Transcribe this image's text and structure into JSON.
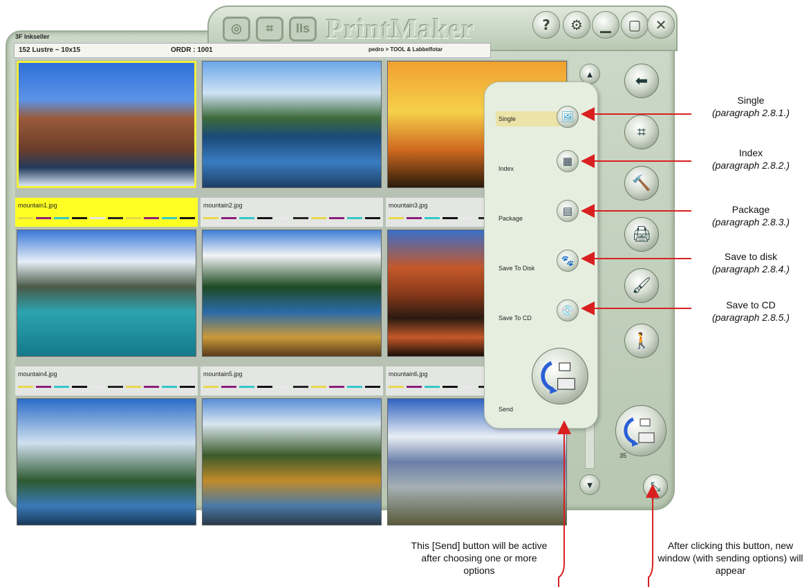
{
  "app": {
    "brand": "PrintMaker",
    "logo_letters": [
      "◎",
      "⌗",
      "IIs"
    ],
    "window_title": "3F Inkseller",
    "paper": "152 Lustre ~ 10x15",
    "order": "ORDR : 1001",
    "path": "pedro > TOOL & Labbelfotar"
  },
  "titlebar_buttons": [
    {
      "name": "help-icon",
      "glyph": "?"
    },
    {
      "name": "settings-gear-icon",
      "glyph": "⚙"
    },
    {
      "name": "minimize-icon",
      "glyph": "▁"
    },
    {
      "name": "maximize-icon",
      "glyph": "▢"
    },
    {
      "name": "close-icon",
      "glyph": "✕"
    }
  ],
  "photos": [
    {
      "name": "mountain1.jpg",
      "selected": true,
      "scene": "rocky-peaks"
    },
    {
      "name": "mountain2.jpg",
      "selected": false,
      "scene": "lake-reflection"
    },
    {
      "name": "mountain3.jpg",
      "selected": false,
      "scene": "palm-sunset"
    },
    {
      "name": "mountain4.jpg",
      "selected": false,
      "scene": "turquoise-lake"
    },
    {
      "name": "mountain5.jpg",
      "selected": false,
      "scene": "forest-lake"
    },
    {
      "name": "mountain6.jpg",
      "selected": false,
      "scene": "red-canyon"
    },
    {
      "name": "",
      "selected": false,
      "scene": "misty-peak"
    },
    {
      "name": "",
      "selected": false,
      "scene": "autumn-valley"
    },
    {
      "name": "",
      "selected": false,
      "scene": "acacia-kilimanjaro"
    }
  ],
  "color_bars": [
    "#e8d84a",
    "#8b1d7a",
    "#33c7c7",
    "#111111",
    "#e8e8e8",
    "#222222",
    "#e8d84a",
    "#8b1d7a",
    "#33c7c7",
    "#111111"
  ],
  "send_menu": {
    "options": [
      {
        "label": "Single",
        "icon": "single-print-icon",
        "highlighted": true
      },
      {
        "label": "Index",
        "icon": "index-grid-icon",
        "highlighted": false
      },
      {
        "label": "Package",
        "icon": "package-icon",
        "highlighted": false
      },
      {
        "label": "Save To Disk",
        "icon": "save-to-disk-icon",
        "highlighted": false
      },
      {
        "label": "Save To CD",
        "icon": "save-to-cd-icon",
        "highlighted": false
      }
    ],
    "send_label": "Send"
  },
  "right_toolbar": [
    {
      "name": "back-arrow-icon",
      "glyph": "⬅"
    },
    {
      "name": "crop-icon",
      "glyph": "⌗"
    },
    {
      "name": "hammer-tool-icon",
      "glyph": "🔨"
    },
    {
      "name": "print-to-printer-icon",
      "glyph": "🖨"
    },
    {
      "name": "brush-color-icon",
      "glyph": "🖌"
    },
    {
      "name": "person-icon",
      "glyph": "🚶"
    }
  ],
  "send_badge": "35",
  "annotations": {
    "callouts": [
      {
        "title": "Single",
        "ref": "(paragraph 2.8.1.)"
      },
      {
        "title": "Index",
        "ref": "(paragraph 2.8.2.)"
      },
      {
        "title": "Package",
        "ref": "(paragraph 2.8.3.)"
      },
      {
        "title": "Save to disk",
        "ref": "(paragraph 2.8.4.)"
      },
      {
        "title": "Save to CD",
        "ref": "(paragraph 2.8.5.)"
      }
    ],
    "send_note": "This [Send] button will be active after choosing one or more options",
    "open_note": "After clicking this button, new window (with sending options) will appear"
  }
}
